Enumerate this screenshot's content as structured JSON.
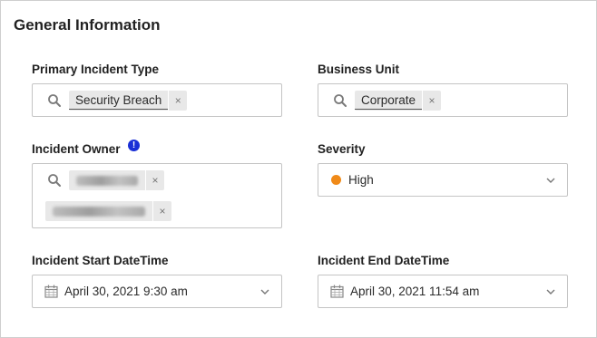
{
  "section_title": "General Information",
  "primary_incident_type": {
    "label": "Primary Incident Type",
    "tag": "Security Breach",
    "remove_symbol": "×"
  },
  "business_unit": {
    "label": "Business Unit",
    "tag": "Corporate",
    "remove_symbol": "×"
  },
  "incident_owner": {
    "label": "Incident Owner",
    "info_symbol": "!",
    "remove_symbol": "×"
  },
  "severity": {
    "label": "Severity",
    "value": "High",
    "dot_color": "#f08a18"
  },
  "incident_start": {
    "label": "Incident Start DateTime",
    "value": "April 30, 2021 9:30 am"
  },
  "incident_end": {
    "label": "Incident End DateTime",
    "value": "April 30, 2021 11:54 am"
  },
  "colors": {
    "border": "#c4c4c4",
    "tag_bg": "#e8e8e8",
    "info_icon": "#1a2fd6"
  }
}
